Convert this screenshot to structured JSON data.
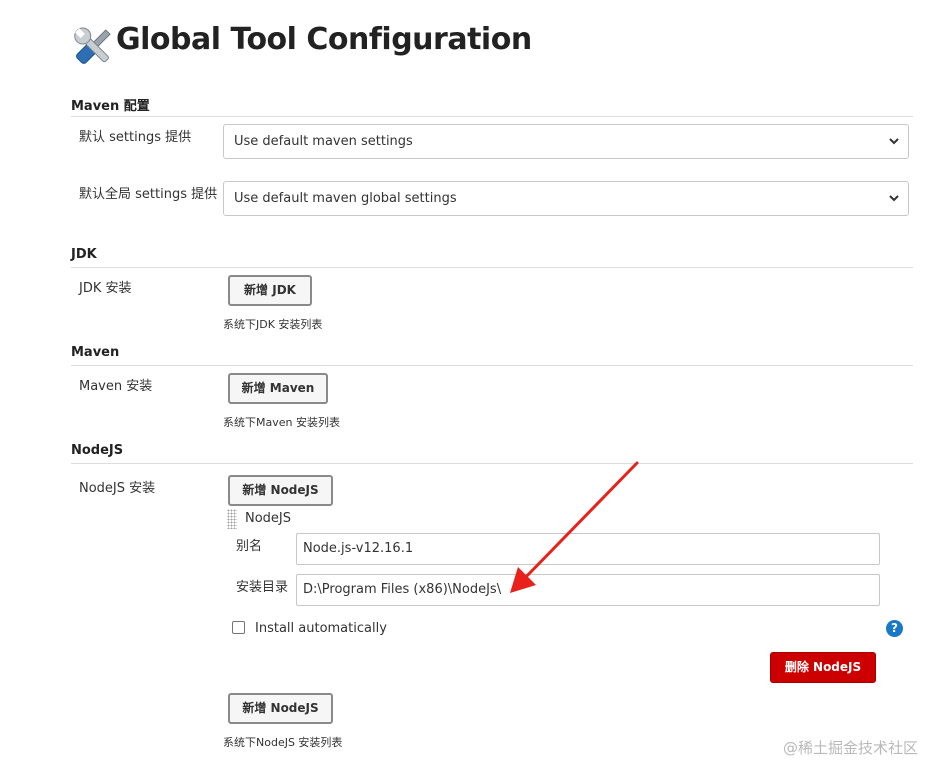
{
  "header": {
    "title": "Global Tool Configuration",
    "icon": "tools-icon"
  },
  "maven_config": {
    "section_title": "Maven 配置",
    "settings_label": "默认 settings 提供",
    "settings_value": "Use default maven settings",
    "global_settings_label": "默认全局 settings 提供",
    "global_settings_value": "Use default maven global settings"
  },
  "jdk": {
    "section_title": "JDK",
    "install_label": "JDK 安装",
    "add_button": "新增 JDK",
    "hint": "系统下JDK 安装列表"
  },
  "maven": {
    "section_title": "Maven",
    "install_label": "Maven 安装",
    "add_button": "新增 Maven",
    "hint": "系统下Maven 安装列表"
  },
  "nodejs": {
    "section_title": "NodeJS",
    "install_label": "NodeJS 安装",
    "add_button_top": "新增 NodeJS",
    "entry": {
      "header": "NodeJS",
      "alias_label": "别名",
      "alias_value": "Node.js-v12.16.1",
      "home_label": "安装目录",
      "home_value": "D:\\Program Files (x86)\\NodeJs\\",
      "install_auto_label": "Install automatically",
      "install_auto_checked": false,
      "delete_button": "删除 NodeJS",
      "help_glyph": "?"
    },
    "add_button_bottom": "新增 NodeJS",
    "hint": "系统下NodeJS 安装列表"
  },
  "watermark": "@稀土掘金技术社区",
  "colors": {
    "danger": "#cc0000",
    "help": "#1a78c8",
    "annotation_arrow": "#e8221b"
  }
}
